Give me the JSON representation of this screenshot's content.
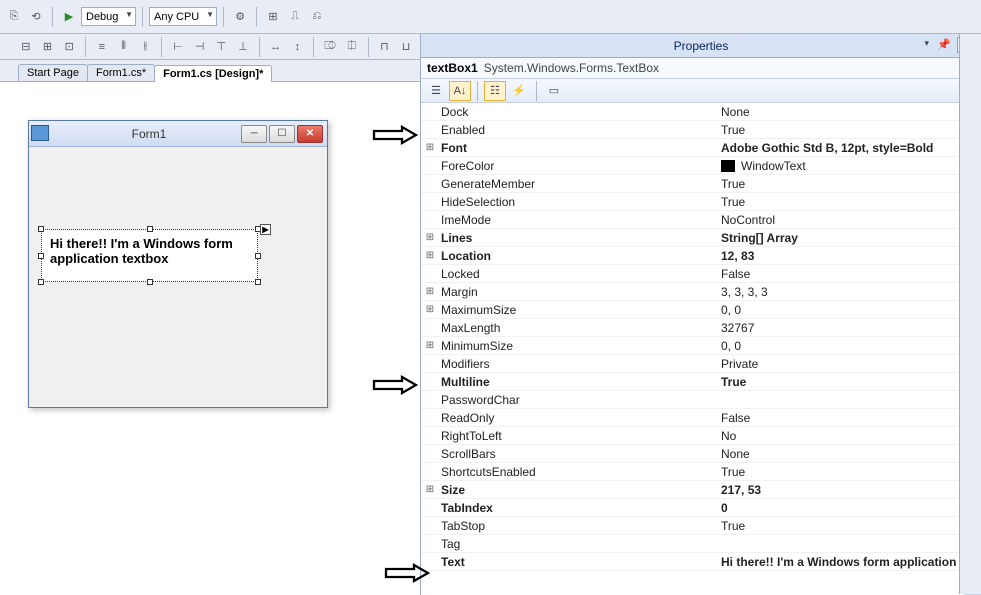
{
  "toolbar": {
    "debug": "Debug",
    "anycpu": "Any CPU",
    "play": "▶"
  },
  "tabs": {
    "start": "Start Page",
    "form_cs": "Form1.cs*",
    "form_design": "Form1.cs [Design]*"
  },
  "form": {
    "title": "Form1",
    "textbox_text": "Hi there!! I'm a Windows form application textbox"
  },
  "properties": {
    "panel_title": "Properties",
    "object_name": "textBox1",
    "object_type": "System.Windows.Forms.TextBox",
    "rows": [
      {
        "exp": "",
        "name": "Dock",
        "value": "None",
        "bold": false
      },
      {
        "exp": "",
        "name": "Enabled",
        "value": "True",
        "bold": false
      },
      {
        "exp": "+",
        "name": "Font",
        "value": "Adobe Gothic Std B, 12pt, style=Bold",
        "bold": true
      },
      {
        "exp": "",
        "name": "ForeColor",
        "value": "WindowText",
        "bold": false,
        "swatch": true
      },
      {
        "exp": "",
        "name": "GenerateMember",
        "value": "True",
        "bold": false
      },
      {
        "exp": "",
        "name": "HideSelection",
        "value": "True",
        "bold": false
      },
      {
        "exp": "",
        "name": "ImeMode",
        "value": "NoControl",
        "bold": false
      },
      {
        "exp": "+",
        "name": "Lines",
        "value": "String[] Array",
        "bold": true
      },
      {
        "exp": "+",
        "name": "Location",
        "value": "12, 83",
        "bold": true
      },
      {
        "exp": "",
        "name": "Locked",
        "value": "False",
        "bold": false
      },
      {
        "exp": "+",
        "name": "Margin",
        "value": "3, 3, 3, 3",
        "bold": false
      },
      {
        "exp": "+",
        "name": "MaximumSize",
        "value": "0, 0",
        "bold": false
      },
      {
        "exp": "",
        "name": "MaxLength",
        "value": "32767",
        "bold": false
      },
      {
        "exp": "+",
        "name": "MinimumSize",
        "value": "0, 0",
        "bold": false
      },
      {
        "exp": "",
        "name": "Modifiers",
        "value": "Private",
        "bold": false
      },
      {
        "exp": "",
        "name": "Multiline",
        "value": "True",
        "bold": true
      },
      {
        "exp": "",
        "name": "PasswordChar",
        "value": "",
        "bold": false
      },
      {
        "exp": "",
        "name": "ReadOnly",
        "value": "False",
        "bold": false
      },
      {
        "exp": "",
        "name": "RightToLeft",
        "value": "No",
        "bold": false
      },
      {
        "exp": "",
        "name": "ScrollBars",
        "value": "None",
        "bold": false
      },
      {
        "exp": "",
        "name": "ShortcutsEnabled",
        "value": "True",
        "bold": false
      },
      {
        "exp": "+",
        "name": "Size",
        "value": "217, 53",
        "bold": true
      },
      {
        "exp": "",
        "name": "TabIndex",
        "value": "0",
        "bold": true
      },
      {
        "exp": "",
        "name": "TabStop",
        "value": "True",
        "bold": false
      },
      {
        "exp": "",
        "name": "Tag",
        "value": "",
        "bold": false
      },
      {
        "exp": "",
        "name": "Text",
        "value": "Hi there!! I'm a Windows form application tex",
        "bold": true
      }
    ]
  }
}
